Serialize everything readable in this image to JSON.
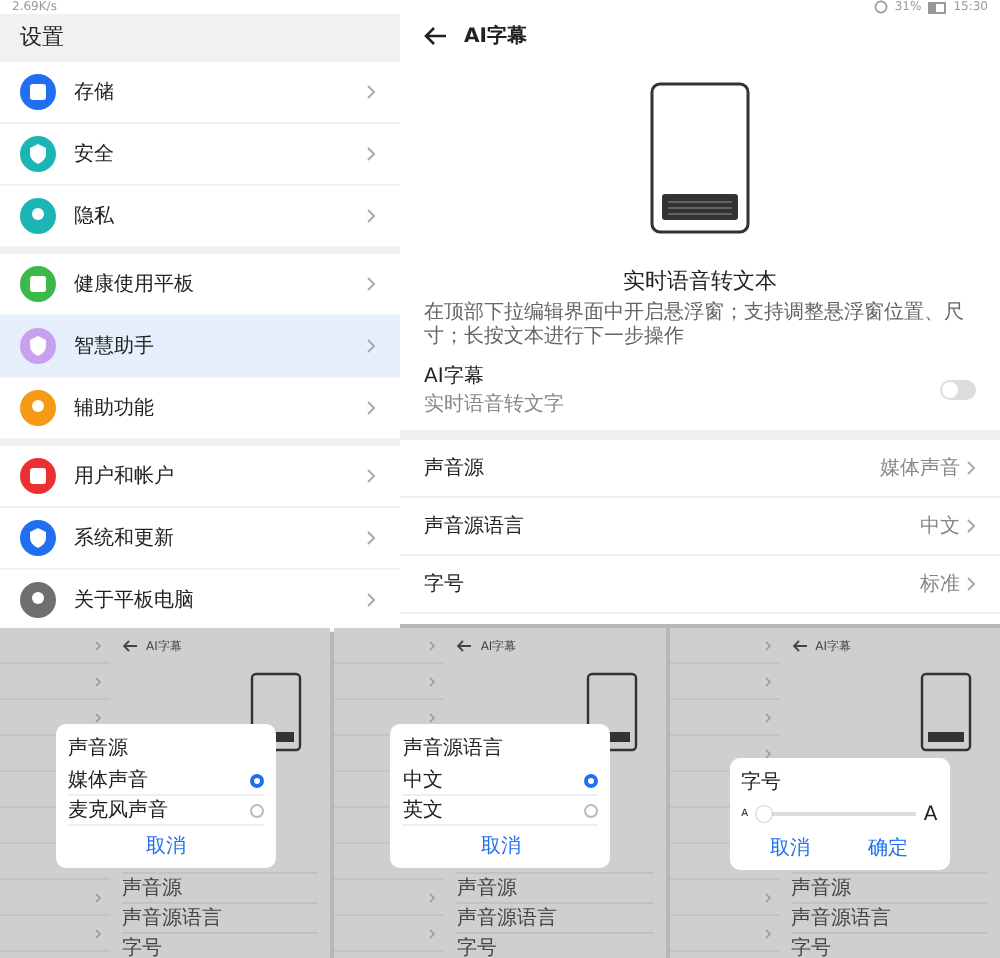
{
  "status_bar": {
    "speed": "2.69K/s",
    "battery": "31%",
    "time": "15:30"
  },
  "settings": {
    "title": "设置",
    "groups": [
      [
        {
          "label": "存储",
          "color": "#1f6ff0",
          "selected": false
        },
        {
          "label": "安全",
          "color": "#1bb5b5",
          "selected": false
        },
        {
          "label": "隐私",
          "color": "#1bb5b5",
          "selected": false
        }
      ],
      [
        {
          "label": "健康使用平板",
          "color": "#3cb94a",
          "selected": false
        },
        {
          "label": "智慧助手",
          "color": "#c9a0f0",
          "selected": true
        },
        {
          "label": "辅助功能",
          "color": "#f59a14",
          "selected": false
        }
      ],
      [
        {
          "label": "用户和帐户",
          "color": "#ec2f2f",
          "selected": false
        },
        {
          "label": "系统和更新",
          "color": "#1f6ff0",
          "selected": false
        },
        {
          "label": "关于平板电脑",
          "color": "#6f6f6f",
          "selected": false
        }
      ]
    ]
  },
  "detail": {
    "title": "AI字幕",
    "caption_title": "实时语音转文本",
    "caption_desc": "在顶部下拉编辑界面中开启悬浮窗；支持调整悬浮窗位置、尺寸；长按文本进行下一步操作",
    "toggle": {
      "label": "AI字幕",
      "sublabel": "实时语音转文字",
      "on": false
    },
    "rows": [
      {
        "label": "声音源",
        "value": "媒体声音"
      },
      {
        "label": "声音源语言",
        "value": "中文"
      },
      {
        "label": "字号",
        "value": "标准"
      }
    ]
  },
  "examples": [
    {
      "title": "AI字幕",
      "rows": [
        "声音源",
        "声音源语言",
        "字号"
      ],
      "dialog": {
        "kind": "radio",
        "title": "声音源",
        "options": [
          {
            "label": "媒体声音",
            "selected": true
          },
          {
            "label": "麦克风声音",
            "selected": false
          }
        ],
        "buttons": [
          "取消"
        ]
      }
    },
    {
      "title": "AI字幕",
      "rows": [
        "声音源",
        "声音源语言",
        "字号"
      ],
      "dialog": {
        "kind": "radio",
        "title": "声音源语言",
        "options": [
          {
            "label": "中文",
            "selected": true
          },
          {
            "label": "英文",
            "selected": false
          }
        ],
        "buttons": [
          "取消"
        ]
      }
    },
    {
      "title": "AI字幕",
      "rows": [
        "声音源",
        "声音源语言",
        "字号"
      ],
      "dialog": {
        "kind": "slider",
        "title": "字号",
        "small_label": "A",
        "large_label": "A",
        "level": 0.05,
        "buttons": [
          "取消",
          "确定"
        ]
      }
    }
  ]
}
